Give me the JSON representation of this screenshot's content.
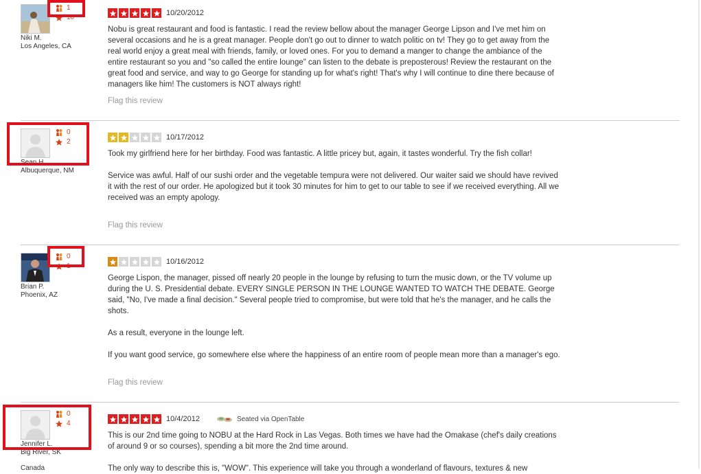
{
  "reviews": [
    {
      "user": {
        "name": "Niki M.",
        "location": "Los Angeles, CA",
        "friends": "1",
        "reviews": "10"
      },
      "rating": 5,
      "date": "10/20/2012",
      "paragraphs": [
        "Nobu is great restaurant and food is fantastic. I read the review bellow about the manager George Lipson and I've met him on several occasions and he is a great manager. People don't go out to dinner to watch politic on tv! They go to get away from the real world enjoy a great meal with friends, family, or loved ones. For you to demand a manger to change the ambiance of the entire restaurant so you and \"so called the entire lounge\" can listen to the debate is preposterous! Review the restaurant on the great food and service, and way to go George for standing up for what's right! That's why I will continue to dine there because of managers like him! The customers is NOT always right!"
      ],
      "flag": "Flag this review"
    },
    {
      "user": {
        "name": "Sean H.",
        "location": "Albuquerque, NM",
        "friends": "0",
        "reviews": "2"
      },
      "rating": 2,
      "date": "10/17/2012",
      "paragraphs": [
        "Took my girlfriend here for her birthday. Food was fantastic. A little pricey but, again, it tastes wonderful. Try the fish collar!",
        "Service was awful. Half of our sushi order and the vegetable tempura were not delivered. Our waiter said we should have revived it with the rest of our order. He apologized but it took 30 minutes for him to get to our table to see if we received everything. All we received was an empty apology."
      ],
      "flag": "Flag this review"
    },
    {
      "user": {
        "name": "Brian P.",
        "location": "Phoenix, AZ",
        "friends": "0",
        "reviews": "1"
      },
      "rating": 1,
      "date": "10/16/2012",
      "paragraphs": [
        "George Lispon, the manager, pissed off nearly 20 people in the lounge by refusing to turn the music down, or the TV volume up during the U. S. Presidential debate.   EVERY SINGLE PERSON IN THE LOUNGE WANTED TO WATCH THE DEBATE.   George said,  \"No,  I've made a final decision.\"   Several people tried to compromise, but were told that he's the manager, and he calls the shots.",
        "As a result,  everyone in the lounge left.",
        "If you want good service, go somewhere else where the happiness of an entire room of people mean more than a manager's ego."
      ],
      "flag": "Flag this review"
    },
    {
      "user": {
        "name": "Jennifer L.",
        "location": "Big River, SK",
        "location2": "Canada",
        "friends": "0",
        "reviews": "4"
      },
      "rating": 5,
      "date": "10/4/2012",
      "seated": "Seated via OpenTable",
      "paragraphs": [
        "This is our 2nd time going to NOBU at the Hard Rock in Las Vegas.  Both times we have had the Omakase (chef's daily creations of around 9 or so courses), spending a bit more the 2nd time around.",
        "The only way to describe this is, \"WOW\". This experience will take you through a wonderland of flavours, textures & new"
      ]
    }
  ],
  "icons": {
    "friends": "friends-icon",
    "reviews": "review-star-icon",
    "rating": "rating-star-icon",
    "opentable": "opentable-icon"
  },
  "colors": {
    "star_red": "#e01d1f",
    "star_yellow": "#e5b81f",
    "star_orange": "#d98a17",
    "star_empty": "#d6d6d6",
    "highlight": "#e0101d",
    "stat": "#d2421b",
    "flag": "#999999"
  }
}
